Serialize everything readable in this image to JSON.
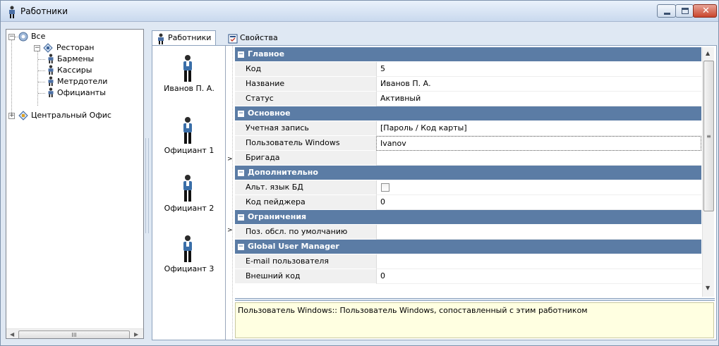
{
  "window": {
    "title": "Работники",
    "buttons": {
      "minimize": "minimize-icon",
      "maximize": "maximize-icon",
      "close": "close-icon"
    }
  },
  "tree": {
    "root": {
      "label": "Все",
      "expanded": true
    },
    "restaurant": {
      "label": "Ресторан",
      "expanded": true
    },
    "children": [
      "Бармены",
      "Кассиры",
      "Метрдотели",
      "Официанты"
    ],
    "office": {
      "label": "Центральный Офис",
      "expanded": false
    },
    "scroll_glyph": "III"
  },
  "tabs": [
    {
      "label": "Работники",
      "active": true
    },
    {
      "label": "Свойства",
      "active": false
    }
  ],
  "employees": [
    "Иванов П. А.",
    "Официант 1",
    "Официант 2",
    "Официант 3"
  ],
  "grid": {
    "cat_main": "Главное",
    "code_label": "Код",
    "code_value": "5",
    "name_label": "Название",
    "name_value": "Иванов П. А.",
    "status_label": "Статус",
    "status_value": "Активный",
    "cat_basic": "Основное",
    "account_label": "Учетная запись",
    "account_value": "[Пароль / Код карты]",
    "winuser_label": "Пользователь Windows",
    "winuser_value": "Ivanov",
    "brigade_label": "Бригада",
    "brigade_value": "",
    "cat_extra": "Дополнительно",
    "altlang_label": "Альт. язык БД",
    "altlang_checked": false,
    "pager_label": "Код пейджера",
    "pager_value": "0",
    "cat_limits": "Ограничения",
    "defservice_label": "Поз. обсл. по умолчанию",
    "defservice_value": "",
    "cat_gum": "Global User Manager",
    "email_label": "E-mail пользователя",
    "email_value": "",
    "extcode_label": "Внешний код",
    "extcode_value": "0"
  },
  "description": "Пользователь Windows:: Пользователь Windows, сопоставленный с этим работником",
  "colors": {
    "category_bg": "#5b7ca5",
    "desc_bg": "#ffffe1",
    "frame_bg": "#dfe8f3"
  }
}
